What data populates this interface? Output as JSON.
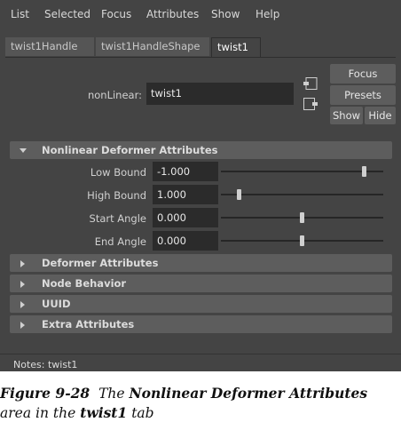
{
  "menubar": {
    "items": [
      "List",
      "Selected",
      "Focus",
      "Attributes",
      "Show",
      "Help"
    ]
  },
  "tabs": [
    {
      "label": "twist1Handle",
      "active": false
    },
    {
      "label": "twist1HandleShape",
      "active": false
    },
    {
      "label": "twist1",
      "active": true
    }
  ],
  "node": {
    "label": "nonLinear:",
    "value": "twist1"
  },
  "buttons": {
    "focus": "Focus",
    "presets": "Presets",
    "show": "Show",
    "hide": "Hide"
  },
  "sections": {
    "nonlinear": {
      "label": "Nonlinear Deformer Attributes",
      "expanded": true,
      "attributes": [
        {
          "label": "Low Bound",
          "value": "-1.000",
          "slider_fraction": 0.88
        },
        {
          "label": "High Bound",
          "value": "1.000",
          "slider_fraction": 0.11
        },
        {
          "label": "Start Angle",
          "value": "0.000",
          "slider_fraction": 0.5
        },
        {
          "label": "End Angle",
          "value": "0.000",
          "slider_fraction": 0.5
        }
      ]
    },
    "collapsed": [
      "Deformer Attributes",
      "Node Behavior",
      "UUID",
      "Extra Attributes"
    ]
  },
  "notes": {
    "label": "Notes:",
    "value": "twist1"
  },
  "caption": {
    "figure": "Figure 9-28",
    "text_pre": "The",
    "bold1": "Nonlinear Deformer Attributes",
    "text_mid": "area in the",
    "bold2": "twist1",
    "text_post": "tab"
  },
  "colors": {
    "panel_bg": "#444444",
    "field_bg": "#2b2b2b",
    "section_bg": "#5d5d5d"
  }
}
